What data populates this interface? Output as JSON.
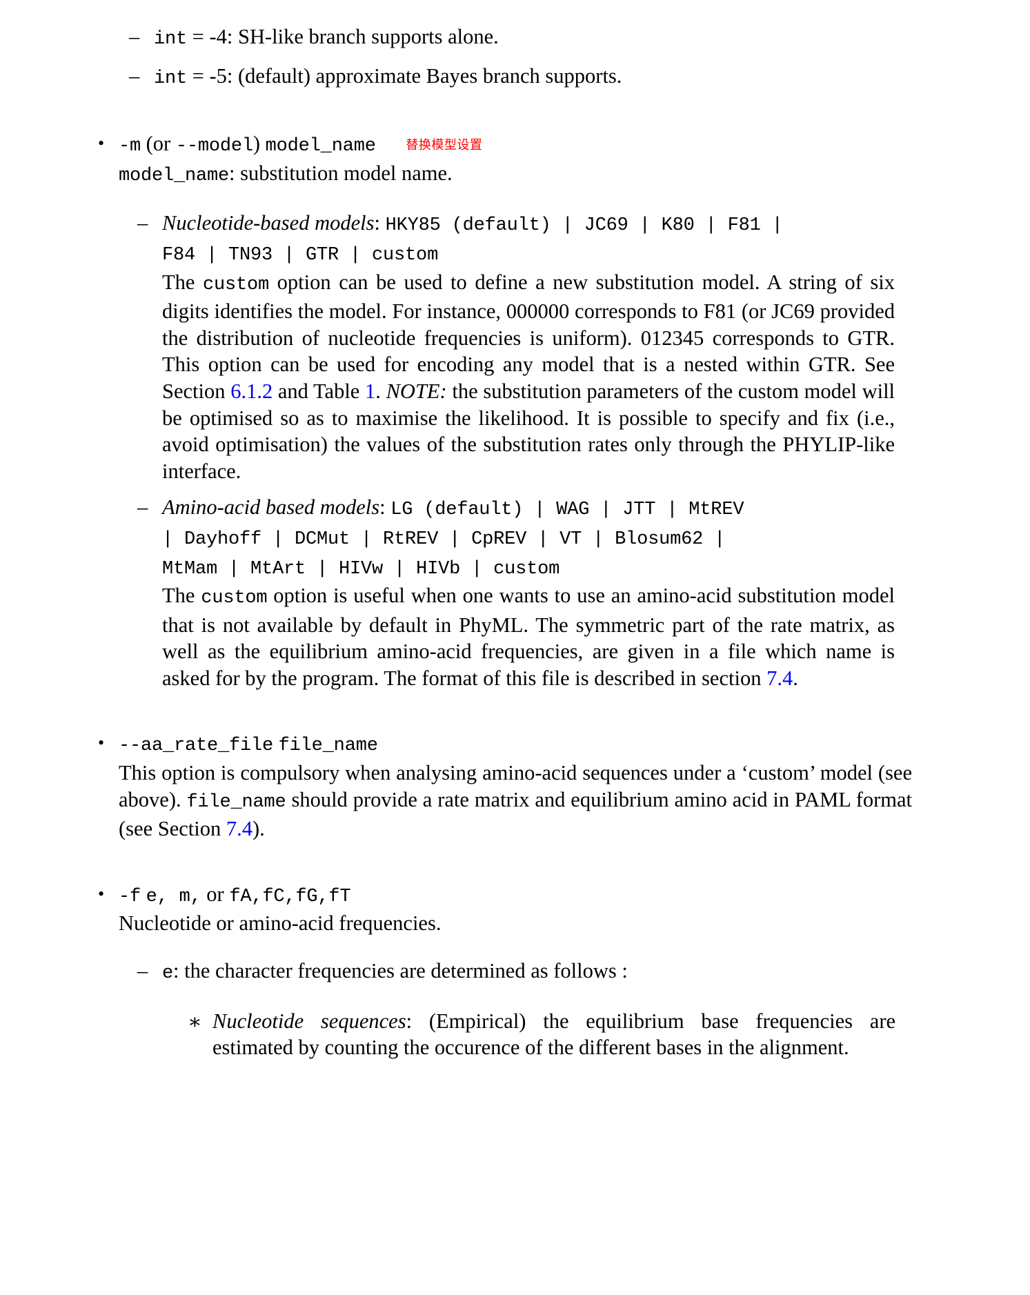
{
  "document": {
    "kind": "latex-manual-page",
    "link_color": "#0000ee",
    "annotation_color": "#ff0000"
  },
  "top_items": {
    "int4": {
      "dash": "–",
      "code": "int",
      "eq": "=",
      "val": "-4:",
      "text": "SH-like branch supports alone."
    },
    "int5": {
      "dash": "–",
      "code": "int",
      "eq": "=",
      "val": "-5:",
      "text": "(default) approximate Bayes branch supports."
    }
  },
  "model_bullet": {
    "bullet": "•",
    "flag": "-m",
    "or_open": "(or",
    "long_flag": "--model",
    "or_close": ")",
    "arg": "model_name",
    "annotation": "替换模型设置",
    "desc_code": "model_name",
    "desc_text": ": substitution model name."
  },
  "nucleotide_models": {
    "dash": "–",
    "heading": "Nucleotide-based models",
    "colon": ":",
    "line1": "HKY85 (default) | JC69 | K80 | F81 |",
    "line2": "F84 | TN93 | GTR | custom",
    "paragraph": {
      "p1": "The",
      "code1": "custom",
      "p2": "option can be used to define a new substitution model. A string of six digits identifies the model. For instance, 000000 corresponds to F81 (or JC69 provided the distribution of nucleotide frequencies is uniform). 012345 corresponds to GTR. This option can be used for encoding any model that is a nested within GTR. See Section",
      "link1": "6.1.2",
      "p3": "and Table",
      "link2": "1",
      "p4": ".",
      "note": "NOTE:",
      "p5": "the substitution parameters of the custom model will be optimised so as to maximise the likelihood. It is possible to specify and fix (i.e., avoid optimisation) the values of the substitution rates only through the PHYLIP-like interface."
    }
  },
  "aminoacid_models": {
    "dash": "–",
    "heading": "Amino-acid based models",
    "colon": ":",
    "line1": "LG (default) | WAG | JTT | MtREV",
    "line2": "| Dayhoff | DCMut | RtREV | CpREV | VT | Blosum62 |",
    "line3": "MtMam | MtArt | HIVw | HIVb | custom",
    "paragraph": {
      "p1": "The",
      "code1": "custom",
      "p2": "option is useful when one wants to use an amino-acid substitution model that is not available by default in PhyML. The symmetric part of the rate matrix, as well as the equilibrium amino-acid frequencies, are given in a file which name is asked for by the program. The format of this file is described in section",
      "link1": "7.4",
      "p3": "."
    }
  },
  "aa_rate_file_bullet": {
    "bullet": "•",
    "flag": "--aa_rate_file",
    "arg": "file_name",
    "paragraph": {
      "p1": "This option is compulsory when analysing amino-acid sequences under a ‘custom’ model (see above).",
      "code1": "file_name",
      "p2": "should provide a rate matrix and equilibrium amino acid in PAML format (see Section",
      "link1": "7.4",
      "p3": ")."
    }
  },
  "freq_bullet": {
    "bullet": "•",
    "flag": "-f",
    "opts1": "e, m,",
    "or": "or",
    "opts2": "fA,fC,fG,fT",
    "desc": "Nucleotide or amino-acid frequencies."
  },
  "freq_sub_e": {
    "dash": "–",
    "code": "e",
    "text": ": the character frequencies are determined as follows :"
  },
  "freq_sub_nucleotide": {
    "star": "∗",
    "heading": "Nucleotide sequences",
    "colon": ":",
    "text": "(Empirical) the equilibrium base frequencies are estimated by counting the occurence of the different bases in the alignment."
  }
}
